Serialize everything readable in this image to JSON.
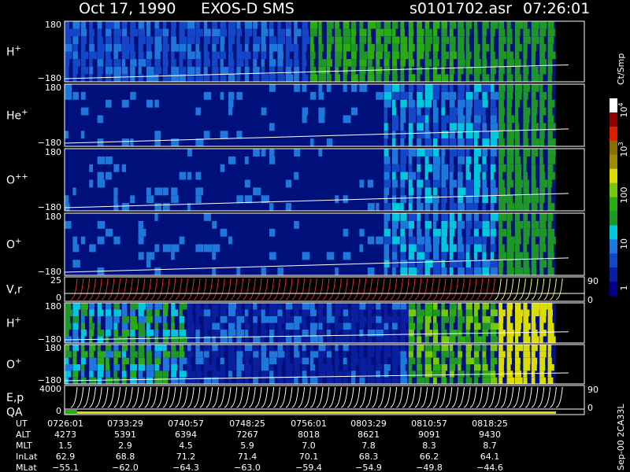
{
  "header": {
    "date": "Oct 17, 1990",
    "instrument": "EXOS-D SMS",
    "file": "s0101702.asr",
    "time": "07:26:01"
  },
  "colorbar": {
    "unit_label": "Ct/Smp",
    "tick_labels": [
      "1",
      "10",
      "100",
      "10",
      "10"
    ],
    "tick_exponents": [
      "",
      "",
      "",
      "3",
      "4"
    ],
    "scale": "log",
    "range": [
      1,
      20000
    ],
    "colors": [
      "#000088",
      "#0a1ea0",
      "#1446c8",
      "#1e78dc",
      "#00c8dc",
      "#1e9628",
      "#2aaa14",
      "#78c80a",
      "#dcdc00",
      "#a08c00",
      "#8c6e00",
      "#dc1e00",
      "#8c0000",
      "#ffffff"
    ]
  },
  "panels": [
    {
      "label": "H",
      "charge": "+",
      "ytop": "180",
      "ybottom": "−180"
    },
    {
      "label": "He",
      "charge": "+",
      "ytop": "180",
      "ybottom": "−180"
    },
    {
      "label": "O",
      "charge": "++",
      "ytop": "180",
      "ybottom": "−180"
    },
    {
      "label": "O",
      "charge": "+",
      "ytop": "180",
      "ybottom": "−180"
    },
    {
      "label": "V,r",
      "charge": "",
      "ytop": "25",
      "ybottom": "0",
      "right_top": "90",
      "right_bottom": "0"
    },
    {
      "label": "H",
      "charge": "+",
      "ytop": "180",
      "ybottom": "−180"
    },
    {
      "label": "O",
      "charge": "+",
      "ytop": "180",
      "ybottom": "−180"
    },
    {
      "label": "E,p",
      "charge": "",
      "ytop": "4000",
      "ybottom": "",
      "right_top": "90",
      "right_bottom": "0"
    },
    {
      "label": "QA",
      "charge": "",
      "ytop": "",
      "ybottom": "0"
    }
  ],
  "side_label": "Sep-00 2CA33L",
  "table": {
    "row_labels": [
      "UT",
      "ALT",
      "MLT",
      "InLat",
      "MLat"
    ],
    "columns": [
      [
        "0726:01",
        "4273",
        "1.5",
        "62.9",
        "−55.1"
      ],
      [
        "0733:29",
        "5391",
        "2.9",
        "68.8",
        "−62.0"
      ],
      [
        "0740:57",
        "6394",
        "4.5",
        "71.2",
        "−64.3"
      ],
      [
        "0748:25",
        "7267",
        "5.9",
        "71.4",
        "−63.0"
      ],
      [
        "0756:01",
        "8018",
        "7.0",
        "70.1",
        "−59.4"
      ],
      [
        "0803:29",
        "8621",
        "7.8",
        "68.3",
        "−54.9"
      ],
      [
        "0810:57",
        "9091",
        "8.3",
        "66.2",
        "−49.8"
      ],
      [
        "0818:25",
        "9430",
        "8.7",
        "64.1",
        "−44.6"
      ]
    ]
  },
  "chart_data": {
    "type": "heatmap",
    "title": "Oct 17, 1990   EXOS-D SMS",
    "x": [
      "0726:01",
      "0733:29",
      "0740:57",
      "0748:25",
      "0756:01",
      "0803:29",
      "0810:57",
      "0818:25"
    ],
    "series": [
      {
        "name": "H+",
        "ylim": [
          -180,
          180
        ]
      },
      {
        "name": "He+",
        "ylim": [
          -180,
          180
        ]
      },
      {
        "name": "O++",
        "ylim": [
          -180,
          180
        ]
      },
      {
        "name": "O+",
        "ylim": [
          -180,
          180
        ]
      },
      {
        "name": "V,r",
        "ylim": [
          0,
          25
        ]
      },
      {
        "name": "H+",
        "ylim": [
          -180,
          180
        ]
      },
      {
        "name": "O+",
        "ylim": [
          -180,
          180
        ]
      },
      {
        "name": "E,p",
        "ylim": [
          0,
          4000
        ]
      },
      {
        "name": "QA"
      }
    ],
    "colorbar": {
      "label": "Ct/Smp",
      "scale": "log",
      "range": [
        1,
        20000
      ]
    }
  }
}
